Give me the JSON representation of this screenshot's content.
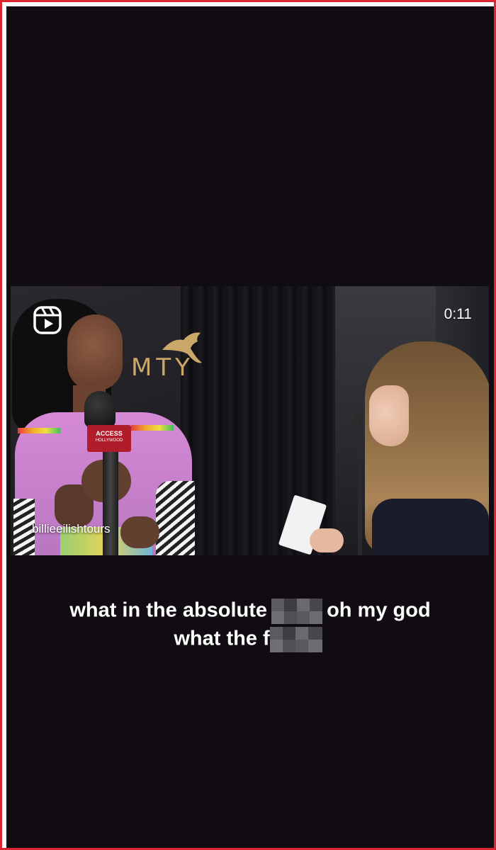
{
  "reel": {
    "duration": "0:11",
    "watermark": "billieeilishtours",
    "backdrop_brand": "MTY",
    "mic_flag_line1": "ACCESS",
    "mic_flag_line2": "HOLLYWOOD",
    "icons": {
      "reels": "reels-icon"
    },
    "colors": {
      "background": "#100c12",
      "border": "#d9262f",
      "caption_text": "#ffffff"
    }
  },
  "captions": {
    "line1_part1": "what in the absolute",
    "line1_part2": "oh my god",
    "line2_part1": "what the f"
  }
}
